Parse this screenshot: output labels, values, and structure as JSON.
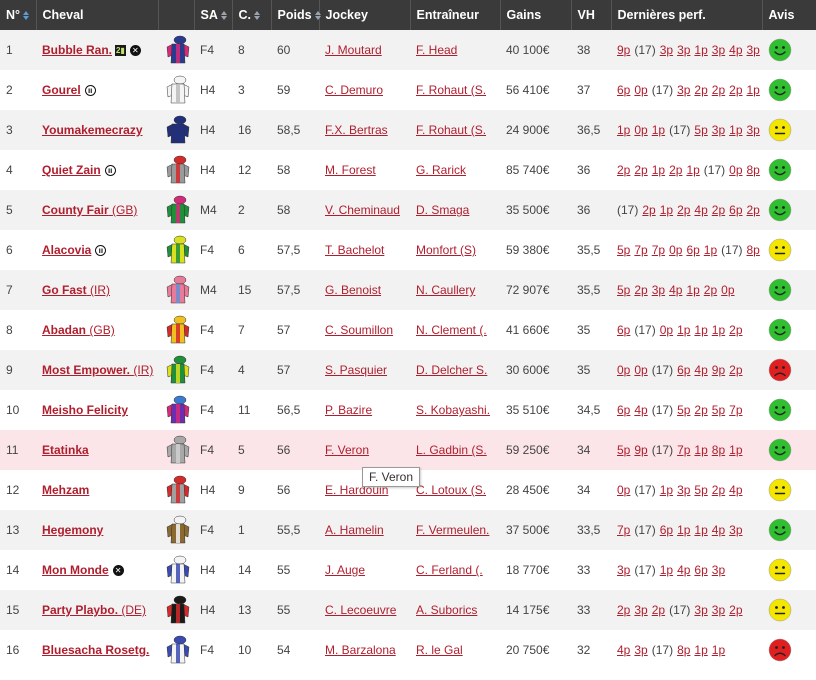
{
  "headers": {
    "num": "N°",
    "cheval": "Cheval",
    "sa": "SA",
    "c": "C.",
    "poids": "Poids",
    "jockey": "Jockey",
    "entraineur": "Entraîneur",
    "gains": "Gains",
    "vh": "VH",
    "perf": "Dernières perf.",
    "avis": "Avis"
  },
  "tooltip": "F. Veron",
  "colors": {
    "accent": "#b01e2e",
    "header_bg": "#3a3a3a",
    "green": "#2fbf2f",
    "yellow": "#f5e600",
    "red": "#e02020",
    "highlight_row": "#fbe5e9"
  },
  "rows": [
    {
      "num": "1",
      "name": "Bubble Ran.",
      "country": "",
      "badges": [
        "eq",
        "x"
      ],
      "sa": "F4",
      "c": "8",
      "poids": "60",
      "jockey": "J. Moutard",
      "trainer": "F. Head",
      "gains": "40 100€",
      "vh": "38",
      "perf": [
        "9p",
        "(17)",
        "3p",
        "3p",
        "1p",
        "3p",
        "4p",
        "3p"
      ],
      "avis": "green",
      "silk": {
        "body": "#2a3b8f",
        "sleeve": "#d42a7a",
        "cap": "#2a3b8f",
        "stripe": "#d42a7a"
      }
    },
    {
      "num": "2",
      "name": "Gourel",
      "country": "",
      "badges": [
        "ii"
      ],
      "sa": "H4",
      "c": "3",
      "poids": "59",
      "jockey": "C. Demuro",
      "trainer": "F. Rohaut (S.",
      "gains": "56 410€",
      "vh": "37",
      "perf": [
        "6p",
        "0p",
        "(17)",
        "3p",
        "2p",
        "2p",
        "2p",
        "1p"
      ],
      "avis": "green",
      "silk": {
        "body": "#f4f4f4",
        "sleeve": "#f4f4f4",
        "cap": "#f4f4f4",
        "stripe": "#bbbbbb"
      }
    },
    {
      "num": "3",
      "name": "Youmakemecrazy",
      "country": "",
      "badges": [],
      "sa": "H4",
      "c": "16",
      "poids": "58,5",
      "jockey": "F.X. Bertras",
      "trainer": "F. Rohaut (S.",
      "gains": "24 900€",
      "vh": "36,5",
      "perf": [
        "1p",
        "0p",
        "1p",
        "(17)",
        "5p",
        "3p",
        "1p",
        "3p"
      ],
      "avis": "yellow",
      "silk": {
        "body": "#22307a",
        "sleeve": "#22307a",
        "cap": "#22307a",
        "stripe": "#22307a"
      }
    },
    {
      "num": "4",
      "name": "Quiet Zain",
      "country": "",
      "badges": [
        "ii"
      ],
      "sa": "H4",
      "c": "12",
      "poids": "58",
      "jockey": "M. Forest",
      "trainer": "G. Rarick",
      "gains": "85 740€",
      "vh": "36",
      "perf": [
        "2p",
        "2p",
        "1p",
        "2p",
        "1p",
        "(17)",
        "0p",
        "8p"
      ],
      "avis": "green",
      "silk": {
        "body": "#9a9a9a",
        "sleeve": "#9a9a9a",
        "cap": "#d42a2a",
        "stripe": "#d42a2a"
      }
    },
    {
      "num": "5",
      "name": "County Fair",
      "country": "(GB)",
      "badges": [],
      "sa": "M4",
      "c": "2",
      "poids": "58",
      "jockey": "V. Cheminaud",
      "trainer": "D. Smaga",
      "gains": "35 500€",
      "vh": "36",
      "perf": [
        "(17)",
        "2p",
        "1p",
        "2p",
        "4p",
        "2p",
        "6p",
        "2p"
      ],
      "avis": "green",
      "silk": {
        "body": "#1f8f3a",
        "sleeve": "#1f8f3a",
        "cap": "#d42a7a",
        "stripe": "#d42a7a"
      }
    },
    {
      "num": "6",
      "name": "Alacovia",
      "country": "",
      "badges": [
        "ii"
      ],
      "sa": "F4",
      "c": "6",
      "poids": "57,5",
      "jockey": "T. Bachelot",
      "trainer": "Monfort (S)",
      "gains": "59 380€",
      "vh": "35,5",
      "perf": [
        "5p",
        "7p",
        "7p",
        "0p",
        "6p",
        "1p",
        "(17)",
        "8p"
      ],
      "avis": "yellow",
      "silk": {
        "body": "#d8e020",
        "sleeve": "#1f8f3a",
        "cap": "#d8e020",
        "stripe": "#1f8f3a"
      }
    },
    {
      "num": "7",
      "name": "Go Fast",
      "country": "(IR)",
      "badges": [],
      "sa": "M4",
      "c": "15",
      "poids": "57,5",
      "jockey": "G. Benoist",
      "trainer": "N. Caullery",
      "gains": "72 907€",
      "vh": "35,5",
      "perf": [
        "5p",
        "2p",
        "3p",
        "4p",
        "1p",
        "2p",
        "0p"
      ],
      "avis": "green",
      "silk": {
        "body": "#e87a9a",
        "sleeve": "#e87a9a",
        "cap": "#e87a9a",
        "stripe": "#6a8fd0"
      }
    },
    {
      "num": "8",
      "name": "Abadan",
      "country": "(GB)",
      "badges": [],
      "sa": "F4",
      "c": "7",
      "poids": "57",
      "jockey": "C. Soumillon",
      "trainer": "N. Clement (.",
      "gains": "41 660€",
      "vh": "35",
      "perf": [
        "6p",
        "(17)",
        "0p",
        "1p",
        "1p",
        "1p",
        "2p"
      ],
      "avis": "green",
      "silk": {
        "body": "#f0c020",
        "sleeve": "#d42a2a",
        "cap": "#f0c020",
        "stripe": "#d42a2a"
      }
    },
    {
      "num": "9",
      "name": "Most Empower.",
      "country": "(IR)",
      "badges": [],
      "sa": "F4",
      "c": "4",
      "poids": "57",
      "jockey": "S. Pasquier",
      "trainer": "D. Delcher S.",
      "gains": "30 600€",
      "vh": "35",
      "perf": [
        "0p",
        "0p",
        "(17)",
        "6p",
        "4p",
        "9p",
        "2p"
      ],
      "avis": "red",
      "silk": {
        "body": "#1f8f3a",
        "sleeve": "#d8e020",
        "cap": "#1f8f3a",
        "stripe": "#d8e020"
      }
    },
    {
      "num": "10",
      "name": "Meisho Felicity",
      "country": "",
      "badges": [],
      "sa": "F4",
      "c": "11",
      "poids": "56,5",
      "jockey": "P. Bazire",
      "trainer": "S. Kobayashi.",
      "gains": "35 510€",
      "vh": "34,5",
      "perf": [
        "6p",
        "4p",
        "(17)",
        "5p",
        "2p",
        "5p",
        "7p"
      ],
      "avis": "green",
      "silk": {
        "body": "#6a2fb0",
        "sleeve": "#d42a7a",
        "cap": "#3a7ad0",
        "stripe": "#d42a7a"
      }
    },
    {
      "num": "11",
      "name": "Etatinka",
      "country": "",
      "badges": [],
      "sa": "F4",
      "c": "5",
      "poids": "56",
      "jockey": "F. Veron",
      "trainer": "L. Gadbin (S.",
      "gains": "59 250€",
      "vh": "34",
      "perf": [
        "5p",
        "9p",
        "(17)",
        "7p",
        "1p",
        "8p",
        "1p"
      ],
      "avis": "green",
      "silk": {
        "body": "#a8a8a8",
        "sleeve": "#a8a8a8",
        "cap": "#a8a8a8",
        "stripe": "#d0d0d0"
      }
    },
    {
      "num": "12",
      "name": "Mehzam",
      "country": "",
      "badges": [],
      "sa": "H4",
      "c": "9",
      "poids": "56",
      "jockey": "E. Hardouin",
      "trainer": "C. Lotoux (S.",
      "gains": "28 450€",
      "vh": "34",
      "perf": [
        "0p",
        "(17)",
        "1p",
        "3p",
        "5p",
        "2p",
        "4p"
      ],
      "avis": "yellow",
      "silk": {
        "body": "#a0a0a0",
        "sleeve": "#d42a2a",
        "cap": "#d42a2a",
        "stripe": "#d42a2a"
      }
    },
    {
      "num": "13",
      "name": "Hegemony",
      "country": "",
      "badges": [],
      "sa": "F4",
      "c": "1",
      "poids": "55,5",
      "jockey": "A. Hamelin",
      "trainer": "F. Vermeulen.",
      "gains": "37 500€",
      "vh": "33,5",
      "perf": [
        "7p",
        "(17)",
        "6p",
        "1p",
        "1p",
        "4p",
        "3p"
      ],
      "avis": "green",
      "silk": {
        "body": "#8a6a30",
        "sleeve": "#8a6a30",
        "cap": "#f4f4f4",
        "stripe": "#f4f4f4"
      }
    },
    {
      "num": "14",
      "name": "Mon Monde",
      "country": "",
      "badges": [
        "x"
      ],
      "sa": "H4",
      "c": "14",
      "poids": "55",
      "jockey": "J. Auge",
      "trainer": "C. Ferland (.",
      "gains": "18 770€",
      "vh": "33",
      "perf": [
        "3p",
        "(17)",
        "1p",
        "4p",
        "6p",
        "3p"
      ],
      "avis": "yellow",
      "silk": {
        "body": "#f4f4f4",
        "sleeve": "#3a4ab0",
        "cap": "#f4f4f4",
        "stripe": "#3a4ab0"
      }
    },
    {
      "num": "15",
      "name": "Party Playbo.",
      "country": "(DE)",
      "badges": [],
      "sa": "H4",
      "c": "13",
      "poids": "55",
      "jockey": "C. Lecoeuvre",
      "trainer": "A. Suborics",
      "gains": "14 175€",
      "vh": "33",
      "perf": [
        "2p",
        "3p",
        "2p",
        "(17)",
        "3p",
        "3p",
        "2p"
      ],
      "avis": "yellow",
      "silk": {
        "body": "#1a1a1a",
        "sleeve": "#d42a2a",
        "cap": "#1a1a1a",
        "stripe": "#d42a2a"
      }
    },
    {
      "num": "16",
      "name": "Bluesacha Rosetg.",
      "country": "",
      "badges": [],
      "sa": "F4",
      "c": "10",
      "poids": "54",
      "jockey": "M. Barzalona",
      "trainer": "R. le Gal",
      "gains": "20 750€",
      "vh": "32",
      "perf": [
        "4p",
        "3p",
        "(17)",
        "8p",
        "1p",
        "1p"
      ],
      "avis": "red",
      "silk": {
        "body": "#f4f4f4",
        "sleeve": "#3a4ab0",
        "cap": "#3a4ab0",
        "stripe": "#3a4ab0"
      }
    }
  ]
}
